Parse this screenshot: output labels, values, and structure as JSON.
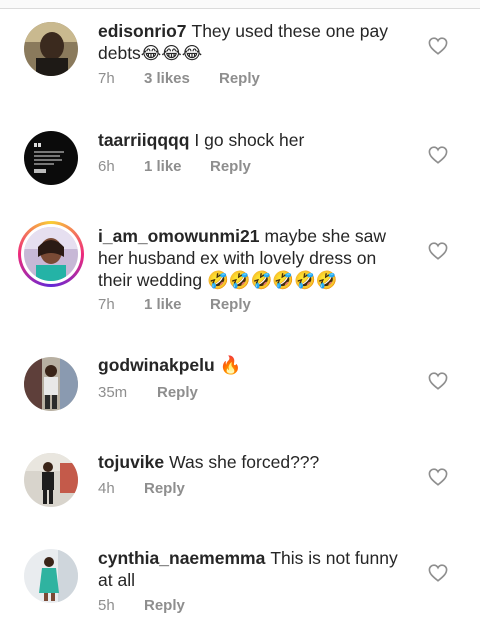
{
  "comments": [
    {
      "username": "edisonrio7",
      "text": "They used these one pay debts😂😂😂",
      "time": "7h",
      "likes": "3 likes",
      "reply": "Reply"
    },
    {
      "username": "taarriiqqqq",
      "text": "I go shock her",
      "time": "6h",
      "likes": "1 like",
      "reply": "Reply"
    },
    {
      "username": "i_am_omowunmi21",
      "text": "maybe she saw her husband ex with lovely dress on their wedding 🤣🤣🤣🤣🤣🤣",
      "time": "7h",
      "likes": "1 like",
      "reply": "Reply"
    },
    {
      "username": "godwinakpelu",
      "text": "🔥",
      "time": "35m",
      "reply": "Reply"
    },
    {
      "username": "tojuvike",
      "text": "Was she forced???",
      "time": "4h",
      "reply": "Reply"
    },
    {
      "username": "cynthia_naememma",
      "text": "This is not funny at all",
      "time": "5h",
      "reply": "Reply"
    }
  ],
  "colors": {
    "text": "#262626",
    "meta": "#8e8e8e",
    "story_ring_start": "#f9ce34",
    "story_ring_mid": "#ee2a7b"
  },
  "icons": {
    "like": "heart-outline-icon"
  }
}
